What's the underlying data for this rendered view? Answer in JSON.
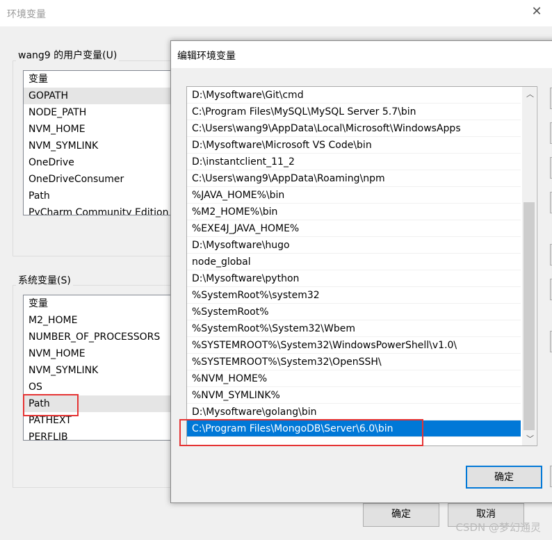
{
  "window": {
    "title": "环境变量",
    "close": "✕"
  },
  "user_vars": {
    "label": "wang9 的用户变量(U)",
    "header": "变量",
    "items": [
      "GOPATH",
      "NODE_PATH",
      "NVM_HOME",
      "NVM_SYMLINK",
      "OneDrive",
      "OneDriveConsumer",
      "Path",
      "PyCharm Community Edition"
    ]
  },
  "system_vars": {
    "label": "系统变量(S)",
    "header": "变量",
    "items": [
      "M2_HOME",
      "NUMBER_OF_PROCESSORS",
      "NVM_HOME",
      "NVM_SYMLINK",
      "OS",
      "Path",
      "PATHEXT",
      "PERFLIB"
    ],
    "highlighted": "Path"
  },
  "buttons": {
    "ok": "确定",
    "cancel": "取消"
  },
  "edit_dialog": {
    "title": "编辑环境变量",
    "ok": "确定",
    "selected": "C:\\Program Files\\MongoDB\\Server\\6.0\\bin",
    "paths": [
      "D:\\Mysoftware\\Git\\cmd",
      "C:\\Program Files\\MySQL\\MySQL Server 5.7\\bin",
      "C:\\Users\\wang9\\AppData\\Local\\Microsoft\\WindowsApps",
      "D:\\Mysoftware\\Microsoft VS Code\\bin",
      "D:\\instantclient_11_2",
      "C:\\Users\\wang9\\AppData\\Roaming\\npm",
      "%JAVA_HOME%\\bin",
      "%M2_HOME%\\bin",
      "%EXE4J_JAVA_HOME%",
      "D:\\Mysoftware\\hugo",
      "node_global",
      "D:\\Mysoftware\\python",
      "%SystemRoot%\\system32",
      "%SystemRoot%",
      "%SystemRoot%\\System32\\Wbem",
      "%SYSTEMROOT%\\System32\\WindowsPowerShell\\v1.0\\",
      "%SYSTEMROOT%\\System32\\OpenSSH\\",
      "%NVM_HOME%",
      "%NVM_SYMLINK%",
      "D:\\Mysoftware\\golang\\bin",
      "C:\\Program Files\\MongoDB\\Server\\6.0\\bin"
    ]
  },
  "watermark": "CSDN @梦幻通灵",
  "colors": {
    "selection": "#0078d7",
    "highlight_box": "#e53333"
  }
}
